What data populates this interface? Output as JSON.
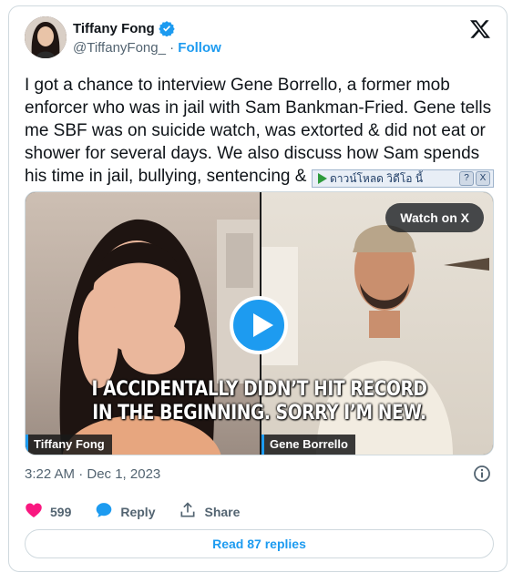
{
  "author": {
    "name": "Tiffany Fong",
    "handle": "@TiffanyFong_",
    "separator": " · ",
    "follow_label": "Follow"
  },
  "tweet": {
    "text": "I got a chance to interview Gene Borrello, a former mob enforcer who was in jail with Sam Bankman-Fried. Gene tells me SBF was on suicide watch, was extorted & did not eat or shower for several days. We also discuss how Sam spends his time in jail, bullying, sentencing & more"
  },
  "overlay": {
    "label": "ดาวน์โหลด วิดีโอ นี้",
    "help": "?",
    "close": "X"
  },
  "media": {
    "watch_label": "Watch on X",
    "caption_line1": "I ACCIDENTALLY DIDN’T HIT RECORD",
    "caption_line2": "IN THE BEGINNING. SORRY I’M NEW.",
    "left_name": "Tiffany Fong",
    "right_name": "Gene Borrello"
  },
  "meta": {
    "timestamp": "3:22 AM · Dec 1, 2023"
  },
  "actions": {
    "likes": "599",
    "reply_label": "Reply",
    "share_label": "Share"
  },
  "footer": {
    "read_replies": "Read 87 replies"
  },
  "colors": {
    "accent": "#1d9bf0",
    "like": "#f91880",
    "text": "#0f1419",
    "muted": "#536471"
  }
}
